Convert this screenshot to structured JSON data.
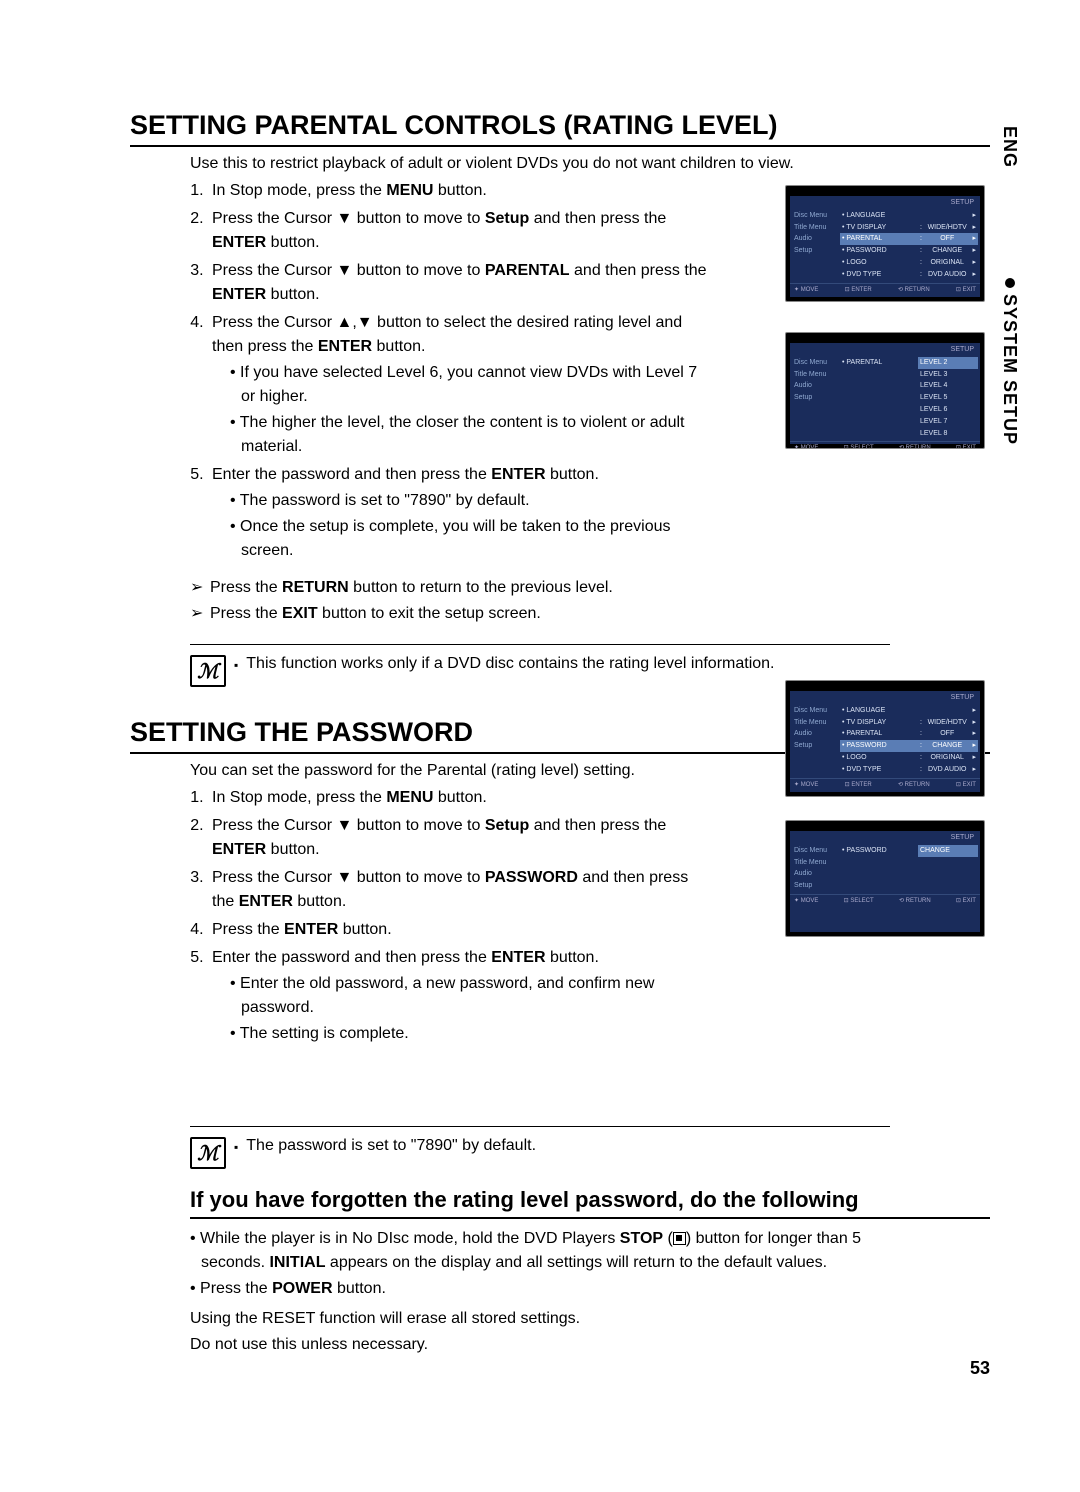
{
  "side": {
    "lang": "ENG",
    "section": "SYSTEM SETUP"
  },
  "sectionA": {
    "title": "SETTING PARENTAL CONTROLS (RATING LEVEL)",
    "intro": "Use this to restrict playback of adult or violent DVDs you do not want children to view.",
    "steps": [
      {
        "pre": "In Stop mode, press the ",
        "b1": "MENU",
        "post": " button."
      },
      {
        "pre": "Press the Cursor ▼ button to move to ",
        "b1": "Setup",
        "mid": " and then press the ",
        "b2": "ENTER",
        "post": " button."
      },
      {
        "pre": "Press the Cursor ▼ button to move to ",
        "b1": "PARENTAL",
        "mid": " and then press the ",
        "b2": "ENTER",
        "post": " button."
      },
      {
        "pre": "Press the Cursor ▲,▼ button to select the desired rating level and then press the ",
        "b1": "ENTER",
        "post": " button.",
        "subs": [
          "If you have selected Level 6, you cannot view DVDs with Level 7 or higher.",
          "The higher the level, the closer the content is to violent or adult material."
        ]
      },
      {
        "pre": "Enter the password and then press the ",
        "b1": "ENTER",
        "post": " button.",
        "subs": [
          "The password is set to \"7890\" by default.",
          "Once the setup is complete, you will be taken to the previous screen."
        ]
      }
    ],
    "arrows": [
      {
        "pre": "Press the ",
        "b": "RETURN",
        "post": " button to return to the previous level."
      },
      {
        "pre": "Press the ",
        "b": "EXIT",
        "post": " button to exit the setup screen."
      }
    ],
    "note": "This function works only if a DVD disc contains the rating level information."
  },
  "sectionB": {
    "title": "SETTING THE PASSWORD",
    "intro": "You can set the password for the Parental (rating level) setting.",
    "steps": [
      {
        "pre": "In Stop mode, press the ",
        "b1": "MENU",
        "post": " button."
      },
      {
        "pre": "Press the Cursor ▼ button to move to ",
        "b1": "Setup",
        "mid": " and then press the ",
        "b2": "ENTER",
        "post": " button."
      },
      {
        "pre": "Press the Cursor ▼ button to move to ",
        "b1": "PASSWORD",
        "mid": " and then press the ",
        "b2": "ENTER",
        "post": " button."
      },
      {
        "pre": "Press the ",
        "b1": "ENTER",
        "post": " button."
      },
      {
        "pre": "Enter the password and then press the ",
        "b1": "ENTER",
        "post": " button.",
        "subs": [
          "Enter the old password, a new password, and confirm new password.",
          "The setting is complete."
        ]
      }
    ],
    "note": "The password is set to \"7890\" by default."
  },
  "sectionC": {
    "title": "If you have forgotten the rating level password, do the following",
    "bullets": [
      {
        "pre": "While the player is in No DIsc mode, hold the DVD Players ",
        "b1": "STOP",
        "mid2": " button for longer than 5 seconds. ",
        "b2": "INITIAL",
        "post": " appears on the display and all settings will return to the default values."
      },
      {
        "pre": "Press the ",
        "b1": "POWER",
        "post": " button."
      }
    ],
    "plain1": "Using the RESET function will erase all stored settings.",
    "plain2": "Do not use this unless necessary."
  },
  "pageNumber": "53",
  "osd": {
    "setup": "SETUP",
    "move": "MOVE",
    "enter": "ENTER",
    "select": "SELECT",
    "return": "RETURN",
    "exit": "EXIT",
    "sidebar": [
      "Disc Menu",
      "Title Menu",
      "Audio",
      "Setup"
    ],
    "screen1": {
      "rows": [
        [
          "LANGUAGE",
          "",
          ""
        ],
        [
          "TV DISPLAY",
          ":",
          "WIDE/HDTV"
        ],
        [
          "PARENTAL",
          ":",
          "OFF"
        ],
        [
          "PASSWORD",
          ":",
          "CHANGE"
        ],
        [
          "LOGO",
          ":",
          "ORIGINAL"
        ],
        [
          "DVD TYPE",
          ":",
          "DVD AUDIO"
        ]
      ],
      "hl": 2
    },
    "screen2": {
      "mid": "PARENTAL",
      "levels": [
        "LEVEL 2",
        "LEVEL 3",
        "LEVEL 4",
        "LEVEL 5",
        "LEVEL 6",
        "LEVEL 7",
        "LEVEL 8"
      ],
      "hl": 0
    },
    "screen3": {
      "rows": [
        [
          "LANGUAGE",
          "",
          ""
        ],
        [
          "TV DISPLAY",
          ":",
          "WIDE/HDTV"
        ],
        [
          "PARENTAL",
          ":",
          "OFF"
        ],
        [
          "PASSWORD",
          ":",
          "CHANGE"
        ],
        [
          "LOGO",
          ":",
          "ORIGINAL"
        ],
        [
          "DVD TYPE",
          ":",
          "DVD AUDIO"
        ]
      ],
      "hl": 3
    },
    "screen4": {
      "mid": "PASSWORD",
      "right": "CHANGE"
    }
  }
}
